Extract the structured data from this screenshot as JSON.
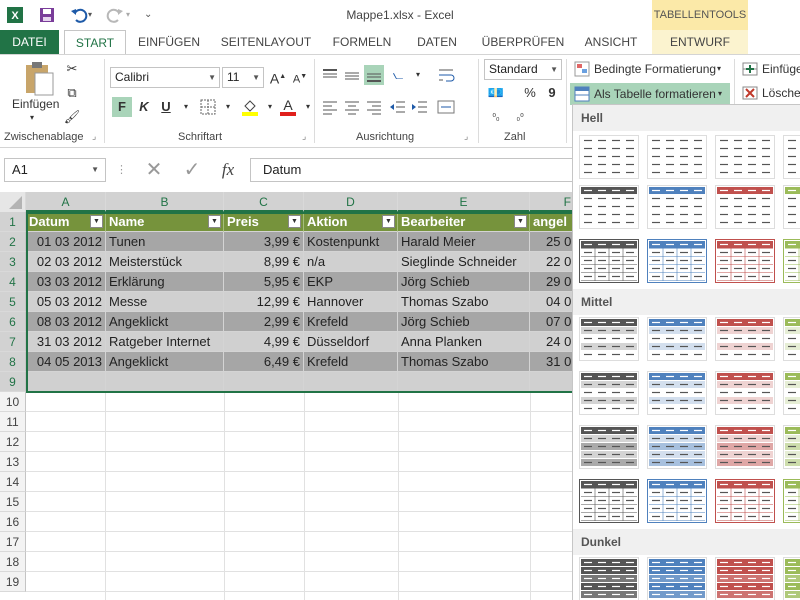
{
  "window": {
    "title": "Mappe1.xlsx - Excel",
    "context_tool": "TABELLENTOOLS"
  },
  "tabs": [
    "DATEI",
    "START",
    "EINFÜGEN",
    "SEITENLAYOUT",
    "FORMELN",
    "DATEN",
    "ÜBERPRÜFEN",
    "ANSICHT",
    "ENTWURF"
  ],
  "ribbon": {
    "paste_label": "Einfügen",
    "font_name": "Calibri",
    "font_size": "11",
    "number_format": "Standard",
    "bold": "F",
    "italic": "K",
    "underline": "U",
    "conditional": "Bedingte Formatierung",
    "as_table": "Als Tabelle formatieren",
    "insert": "Einfüge",
    "delete": "Lösche",
    "groups": [
      "Zwischenablage",
      "Schriftart",
      "Ausrichtung",
      "Zahl"
    ]
  },
  "formula": {
    "name_box": "A1",
    "fx": "fx",
    "content": "Datum"
  },
  "sheet": {
    "columns": [
      "A",
      "B",
      "C",
      "D",
      "E",
      "F"
    ],
    "rows": [
      "1",
      "2",
      "3",
      "4",
      "5",
      "6",
      "7",
      "8",
      "9",
      "10",
      "11",
      "12",
      "13",
      "14",
      "15",
      "16",
      "17",
      "18",
      "19"
    ],
    "headers": [
      "Datum",
      "Name",
      "Preis",
      "Aktion",
      "Bearbeiter",
      "angel"
    ],
    "data": [
      [
        "01 03 2012",
        "Tunen",
        "3,99 €",
        "Kostenpunkt",
        "Harald Meier",
        "25 0"
      ],
      [
        "02 03 2012",
        "Meisterstück",
        "8,99 €",
        "n/a",
        "Sieglinde Schneider",
        "22 0"
      ],
      [
        "03 03 2012",
        "Erklärung",
        "5,95 €",
        "EKP",
        "Jörg Schieb",
        "29 0"
      ],
      [
        "05 03 2012",
        "Messe",
        "12,99 €",
        "Hannover",
        "Thomas Szabo",
        "04 0"
      ],
      [
        "08 03 2012",
        "Angeklickt",
        "2,99 €",
        "Krefeld",
        "Jörg Schieb",
        "07 0"
      ],
      [
        "31 03 2012",
        "Ratgeber Internet",
        "4,99 €",
        "Düsseldorf",
        "Anna Planken",
        "24 0"
      ],
      [
        "04 05 2013",
        "Angeklickt",
        "6,49 €",
        "Krefeld",
        "Thomas Szabo",
        "31 0"
      ]
    ]
  },
  "gallery": {
    "sections": [
      "Hell",
      "Mittel",
      "Dunkel"
    ],
    "palette": [
      "#555555",
      "#4f81bd",
      "#c0504d",
      "#9bbb59"
    ]
  },
  "colors": {
    "excel_green": "#217346",
    "table_header": "#76933c",
    "band_dark": "#a6a6a6",
    "band_light": "#d0d0d0"
  }
}
